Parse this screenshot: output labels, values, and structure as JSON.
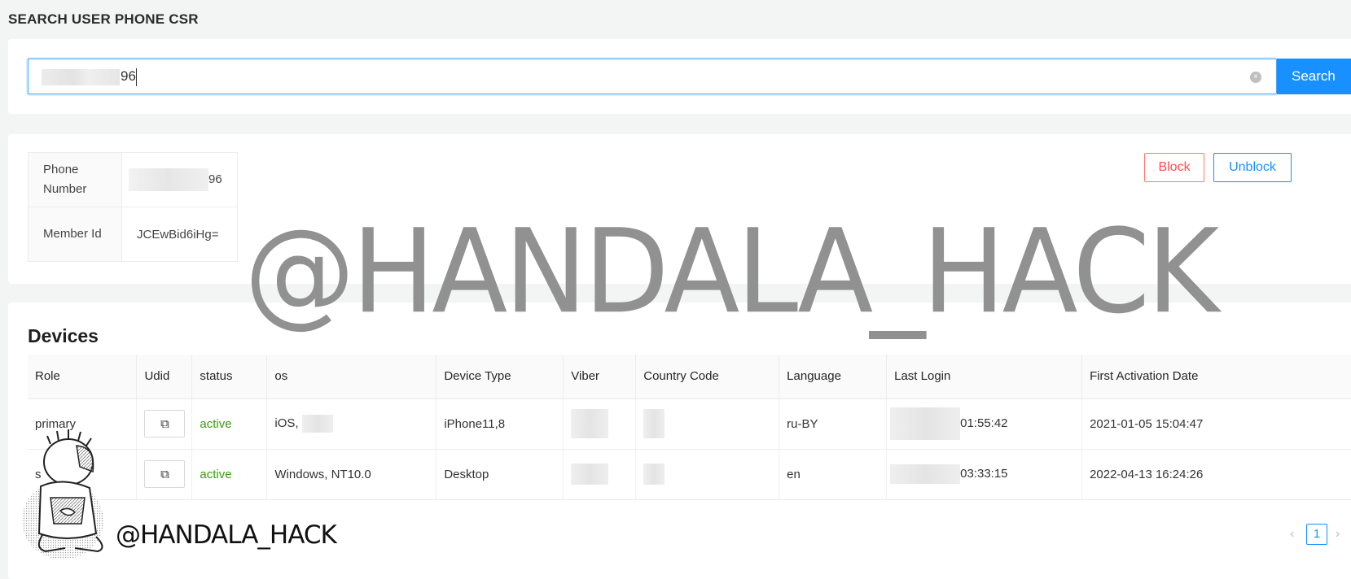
{
  "page_title": "SEARCH USER PHONE CSR",
  "search": {
    "value": "96",
    "button_label": "Search",
    "clear_glyph": "×"
  },
  "user_info": {
    "rows": [
      {
        "label": "Phone Number",
        "value": "96"
      },
      {
        "label": "Member Id",
        "value": "JCEwBid6iHg="
      }
    ],
    "block_label": "Block",
    "unblock_label": "Unblock"
  },
  "devices": {
    "title": "Devices",
    "columns": [
      "Role",
      "Udid",
      "status",
      "os",
      "Device Type",
      "Viber",
      "Country Code",
      "Language",
      "Last Login",
      "First Activation Date"
    ],
    "rows": [
      {
        "role": "primary",
        "status": "active",
        "os": "iOS,",
        "device_type": "iPhone11,8",
        "language": "ru-BY",
        "last_login": "01:55:42",
        "first_activation": "2021-01-05 15:04:47"
      },
      {
        "role": "s",
        "status": "active",
        "os": "Windows, NT10.0",
        "device_type": "Desktop",
        "language": "en",
        "last_login": "03:33:15",
        "first_activation": "2022-04-13 16:24:26"
      }
    ],
    "copy_icon": "copy-icon"
  },
  "pagination": {
    "prev": "‹",
    "current": "1",
    "next": "›"
  },
  "watermark": "@HANDALA_HACK",
  "logo_text": "@HANDALA_HACK",
  "colors": {
    "primary": "#1890ff",
    "danger": "#ff4d4f",
    "success": "#389e0d",
    "background": "#f3f5f5"
  }
}
